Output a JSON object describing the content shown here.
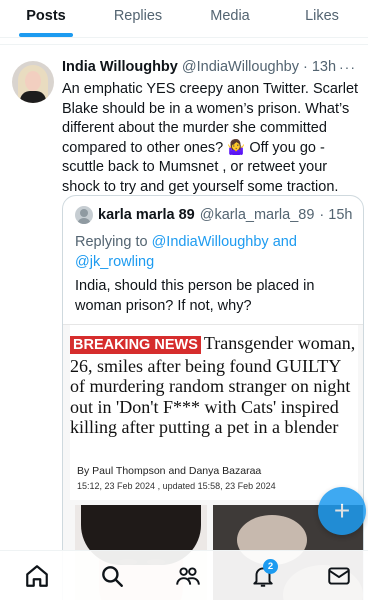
{
  "tabs": [
    {
      "label": "Posts",
      "active": true
    },
    {
      "label": "Replies",
      "active": false
    },
    {
      "label": "Media",
      "active": false
    },
    {
      "label": "Likes",
      "active": false
    }
  ],
  "tweet": {
    "name": "India Willoughby",
    "handle": "@IndiaWilloughby",
    "time": "· 13h",
    "more": "···",
    "text": "An emphatic YES creepy anon Twitter. Scarlet Blake should be in a women’s prison. What’s different about the murder she committed compared to other ones? 🤷‍♀️ Off you go - scuttle back to Mumsnet , or retweet your shock to try and get yourself some traction."
  },
  "quote": {
    "name": "karla marla 89",
    "handle": "@karla_marla_89",
    "time": "· 15h",
    "replying_prefix": "Replying to ",
    "replying_to_1": "@IndiaWilloughby",
    "replying_and": " and",
    "replying_to_2": "@jk_rowling",
    "text": "India, should this person be placed in woman prison? If not, why?",
    "article": {
      "breaking": "BREAKING NEWS",
      "headline": "Transgender woman, 26, smiles after being found GUILTY of murdering random stranger on night out in 'Don't F*** with Cats' inspired killing after putting a pet in a blender",
      "byline": "By Paul Thompson and Danya Bazaraa",
      "dateline": "15:12, 23 Feb 2024 , updated 15:58, 23 Feb 2024"
    }
  },
  "compose_button": "+",
  "bottom_nav": [
    {
      "icon": "home-icon"
    },
    {
      "icon": "search-icon"
    },
    {
      "icon": "communities-icon"
    },
    {
      "icon": "notifications-icon",
      "badge": "2"
    },
    {
      "icon": "messages-icon"
    }
  ],
  "colors": {
    "accent": "#1d9bf0",
    "breaking": "#d62d2d",
    "text": "#0f1419",
    "muted": "#536471"
  }
}
